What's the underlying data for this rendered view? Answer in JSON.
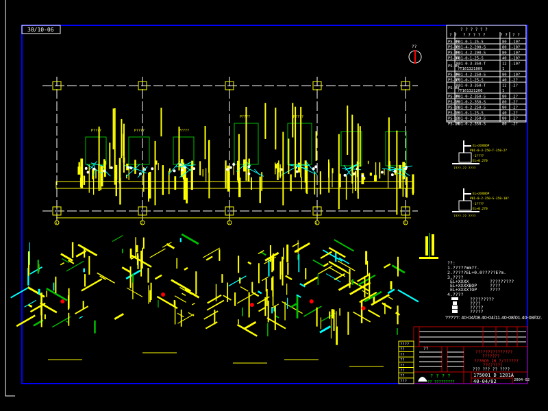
{
  "sheet": {
    "label": "30/10-06",
    "north_label": "??"
  },
  "grid": {
    "column_labels": [
      "1",
      "2",
      "3",
      "4",
      "5"
    ]
  },
  "plan_labels": [
    "P????",
    "P????",
    "P????",
    "P????",
    "P????"
  ],
  "line_table": {
    "header_top": "? ? ? ? ? ?",
    "headers": [
      "? ?",
      "? ? ? ? ?",
      "? ?",
      "? ?"
    ],
    "rows": [
      {
        "id": "PS-01",
        "line": "P01-0-1-25-S",
        "len": "80",
        "note": "-10?"
      },
      {
        "id": "PS-02",
        "line": "P01-4-2-200-S",
        "len": "80",
        "note": "-10?"
      },
      {
        "id": "PS-03",
        "line": "P01-4-2-200-S",
        "len": "80",
        "note": "-10?"
      },
      {
        "id": "PS-04",
        "line": "P01-0-1-25-S",
        "len": "40",
        "note": "-10?"
      },
      {
        "id": "PS-05",
        "line": "P01-0-3-350-T",
        "len": "12",
        "note": "-10?",
        "sub": "?T161321009",
        "sub_val": "1"
      },
      {
        "id": "PS-06",
        "line": "P01-4-2-250-S",
        "len": "80",
        "note": "-10?"
      },
      {
        "id": "PS-07",
        "line": "P01-0-1-25-S",
        "len": "40",
        "note": "-2?"
      },
      {
        "id": "PS-08",
        "line": "P01-0-3-350-T",
        "len": "12",
        "note": "-2?",
        "sub": "?T161321206",
        "sub_val": "1"
      },
      {
        "id": "PS-09",
        "line": "P01-0-2-350-S",
        "len": "80",
        "note": "-2?"
      },
      {
        "id": "PS-10",
        "line": "P01-0-2-350-S",
        "len": "80",
        "note": "-2?"
      },
      {
        "id": "PS-11",
        "line": "P01-0-2-250-S",
        "len": "80",
        "note": "-2?"
      },
      {
        "id": "PS-12",
        "line": "P01-0-1-25-S",
        "len": "40",
        "note": "-2?"
      },
      {
        "id": "PS-13",
        "line": "P01-0-2-350-S",
        "len": "80",
        "note": "-2?"
      },
      {
        "id": "PS-14",
        "line": "P01-0-2-350-S",
        "len": "80",
        "note": "-2?"
      }
    ]
  },
  "details": [
    {
      "callout_top": "EL+XXXBOP",
      "callout_line": "P01-0-3-250-T-350-2?",
      "callout_mid": "-1????",
      "callout_low": "EL+0.270",
      "caption": "????-?? ????"
    },
    {
      "callout_top": "EL+XXXBOP",
      "callout_line": "P01-0-2-350-S-350-10?",
      "callout_mid": "-1????",
      "callout_low": "EL+0.270",
      "caption": "????-?? ????"
    }
  ],
  "notes": {
    "title": "??:",
    "lines": [
      "1.?????mm??.",
      "2.?????EL+0.0?????E?m.",
      "3.????"
    ],
    "el_items": [
      {
        "code": "EL+XXXX",
        "desc": "?????????"
      },
      {
        "code": "EL+XXXXBOP",
        "desc": "????"
      },
      {
        "code": "EL+XXXXTOP",
        "desc": "????"
      }
    ],
    "legend_title": "4.????",
    "legend_items": [
      "?????????",
      "????",
      "?????",
      "?????"
    ],
    "revision": "?????: 40-04/08.40-04/11.40-08/01.40-08/02."
  },
  "title_block": {
    "left_labels": [
      "????",
      "??",
      "??",
      "??",
      "??",
      "??",
      "??",
      "???"
    ],
    "project_lines": [
      "???????????????",
      "???????",
      "???0C0.10 ?/??????",
      "??(????)"
    ],
    "scale_row": "??? ??? ??  ????",
    "company": "? ? ? ?",
    "company_sub": "?? ?????????",
    "drawing_no": "175001 D 1201A",
    "date": "40-04/02",
    "sheet_no": "2004-02",
    "mid_label": "??"
  },
  "colors": {
    "frame": "#0000ff",
    "pipe": "#ffff00",
    "equipment": "#00c000",
    "instrument": "#00ffff",
    "title_block": "#c00000",
    "text": "#ffffff"
  }
}
